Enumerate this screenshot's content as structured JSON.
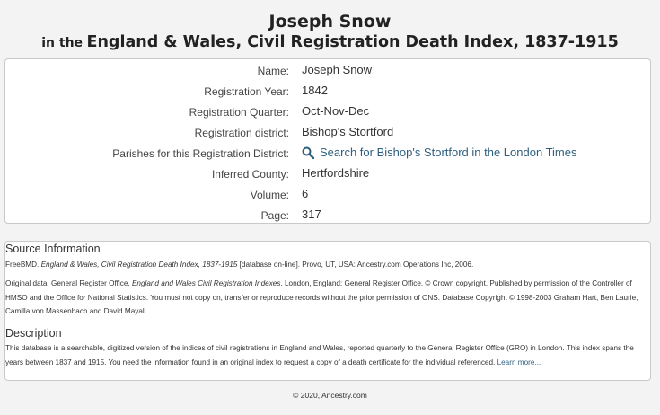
{
  "header": {
    "name": "Joseph Snow",
    "prefix": "in the",
    "collection": "England & Wales, Civil Registration Death Index, 1837-1915"
  },
  "record": {
    "fields": [
      {
        "label": "Name:",
        "value": "Joseph Snow"
      },
      {
        "label": "Registration Year:",
        "value": "1842"
      },
      {
        "label": "Registration Quarter:",
        "value": "Oct-Nov-Dec"
      },
      {
        "label": "Registration district:",
        "value": "Bishop's Stortford"
      },
      {
        "label": "Parishes for this Registration District:",
        "value": "Search for Bishop's Stortford in the London Times",
        "icon": "search-icon",
        "link": true
      },
      {
        "label": "Inferred County:",
        "value": "Hertfordshire"
      },
      {
        "label": "Volume:",
        "value": "6"
      },
      {
        "label": "Page:",
        "value": "317"
      }
    ]
  },
  "source": {
    "heading": "Source Information",
    "citation_prefix": "FreeBMD. ",
    "citation_title": "England & Wales, Civil Registration Death Index, 1837-1915",
    "citation_suffix": " [database on-line]. Provo, UT, USA: Ancestry.com Operations Inc, 2006.",
    "original_prefix": "Original data: General Register Office. ",
    "original_title": "England and Wales Civil Registration Indexes",
    "original_suffix": ". London, England: General Register Office. © Crown copyright. Published by permission of the Controller of HMSO and the Office for National Statistics. You must not copy on, transfer or reproduce records without the prior permission of ONS. Database Copyright © 1998-2003 Graham Hart, Ben Laurie, Camilla von Massenbach and David Mayall.",
    "description_heading": "Description",
    "description_text": "This database is a searchable, digitized version of the indices of civil registrations in England and Wales, reported quarterly to the General Register Office (GRO) in London. This index spans the years between 1837 and 1915. You need the information found in an original index to request a copy of a death certificate for the individual referenced. ",
    "learn_more": "Learn more..."
  },
  "footer": {
    "copyright": "© 2020, Ancestry.com"
  },
  "colors": {
    "link": "#2f5f7f",
    "background": "#f4f3f3",
    "border": "#c9c9c9"
  }
}
